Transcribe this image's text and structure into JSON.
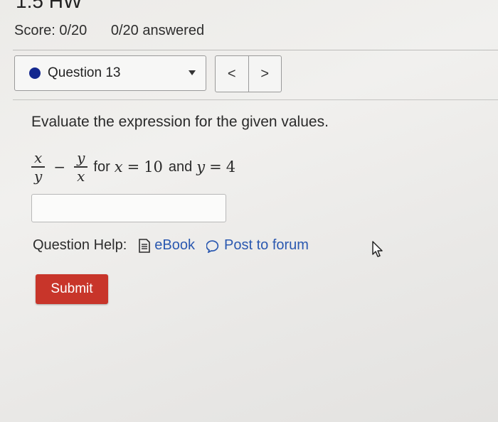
{
  "header": {
    "title": "1.5 HW",
    "score": "Score: 0/20",
    "answered": "0/20 answered"
  },
  "question_nav": {
    "current": "Question 13",
    "prev_label": "<",
    "next_label": ">"
  },
  "question": {
    "prompt": "Evaluate the expression for the given values.",
    "expression": {
      "frac1_num": "x",
      "frac1_den": "y",
      "minus": "−",
      "frac2_num": "y",
      "frac2_den": "x",
      "for_text": "for",
      "var_x": "x",
      "eq1": "=",
      "x_value": "10",
      "and_text": "and",
      "var_y": "y",
      "eq2": "=",
      "y_value": "4"
    },
    "answer_value": ""
  },
  "help": {
    "label": "Question Help:",
    "ebook": "eBook",
    "forum": "Post to forum"
  },
  "submit_label": "Submit",
  "colors": {
    "accent_dot": "#14288f",
    "link": "#2a58b0",
    "submit_bg": "#c8352a"
  }
}
